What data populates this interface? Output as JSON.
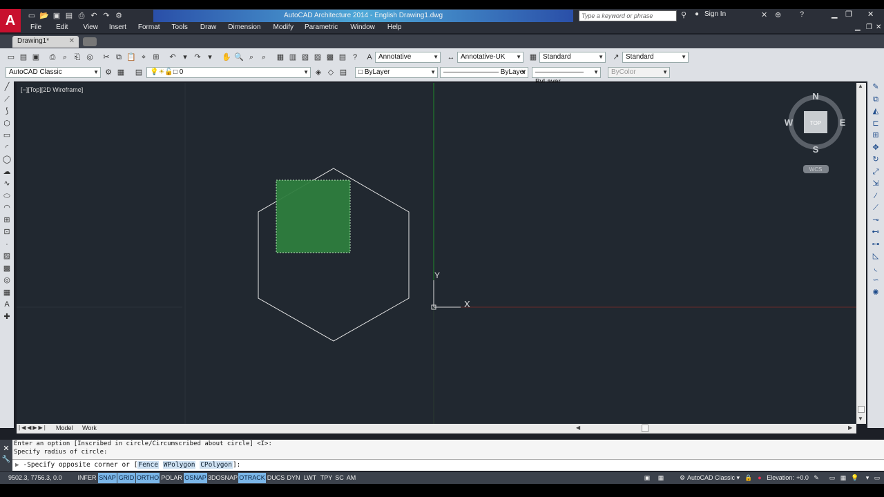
{
  "window": {
    "title": "AutoCAD Architecture 2014 - English   Drawing1.dwg",
    "search_placeholder": "Type a keyword or phrase",
    "signin": "Sign In"
  },
  "menu": [
    "File",
    "Edit",
    "View",
    "Insert",
    "Format",
    "Tools",
    "Draw",
    "Dimension",
    "Modify",
    "Parametric",
    "Window",
    "Help"
  ],
  "doc_tab": "Drawing1*",
  "toolbars": {
    "workspace": "AutoCAD Classic",
    "layer": "0",
    "text_style": "Annotative",
    "dim_style": "Annotative-UK",
    "table_style": "Standard",
    "mleader_style": "Standard",
    "color": "ByLayer",
    "linetype": "ByLayer",
    "lineweight": "ByLayer",
    "plotstyle": "ByColor"
  },
  "viewport": {
    "label": "[−][Top][2D Wireframe]",
    "viewcube": {
      "n": "N",
      "s": "S",
      "e": "E",
      "w": "W",
      "face": "TOP",
      "ucs": "WCS"
    },
    "ucs_x": "X",
    "ucs_y": "Y"
  },
  "layout_tabs": {
    "model": "Model",
    "layout": "Work"
  },
  "command": {
    "line1": "Enter an option [Inscribed in circle/Circumscribed about circle] <I>:",
    "line2": "Specify radius of circle:",
    "prompt": "-Specify opposite corner or [",
    "opt1": "Fence",
    "opt2": "WPolygon",
    "opt3": "CPolygon",
    "suffix": "]:"
  },
  "status": {
    "coords": "9502.3, 7756.3, 0.0",
    "buttons": [
      "INFER",
      "SNAP",
      "GRID",
      "ORTHO",
      "POLAR",
      "OSNAP",
      "3DOSNAP",
      "OTRACK",
      "DUCS",
      "DYN",
      "LWT",
      "TPY",
      "SC",
      "AM"
    ],
    "workspace": "AutoCAD Classic",
    "elevation": "Elevation:",
    "elevation_value": "+0.0"
  },
  "colors": {
    "canvas": "#212830",
    "selection_fill": "#2e7d3e",
    "accent_status": "#7ab6e8"
  }
}
